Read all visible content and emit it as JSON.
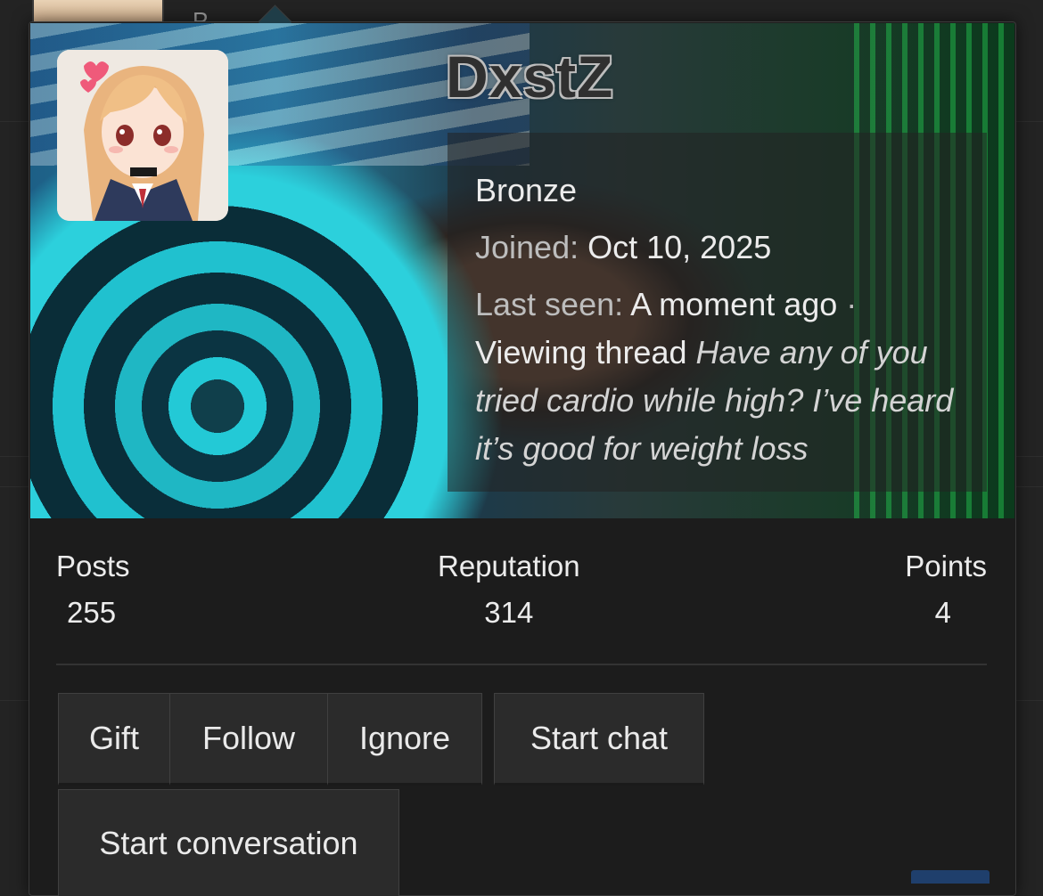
{
  "profile": {
    "username": "DxstZ",
    "rank": "Bronze",
    "joined_label": "Joined:",
    "joined_value": "Oct 10, 2025",
    "last_seen_label": "Last seen:",
    "last_seen_value": "A moment ago",
    "separator": "·",
    "activity": "Viewing thread",
    "thread_title": "Have any of you tried cardio while high? I’ve heard it’s good for weight loss"
  },
  "stats": [
    {
      "label": "Posts",
      "value": "255"
    },
    {
      "label": "Reputation",
      "value": "314"
    },
    {
      "label": "Points",
      "value": "4"
    }
  ],
  "actions": {
    "gift": "Gift",
    "follow": "Follow",
    "ignore": "Ignore",
    "start_chat": "Start chat",
    "start_conversation": "Start conversation"
  },
  "background": {
    "partial_letter": "P"
  },
  "colors": {
    "popup_bg": "#1c1c1c",
    "button_bg": "#2b2b2b",
    "accent_blue": "#1f3f6c"
  }
}
